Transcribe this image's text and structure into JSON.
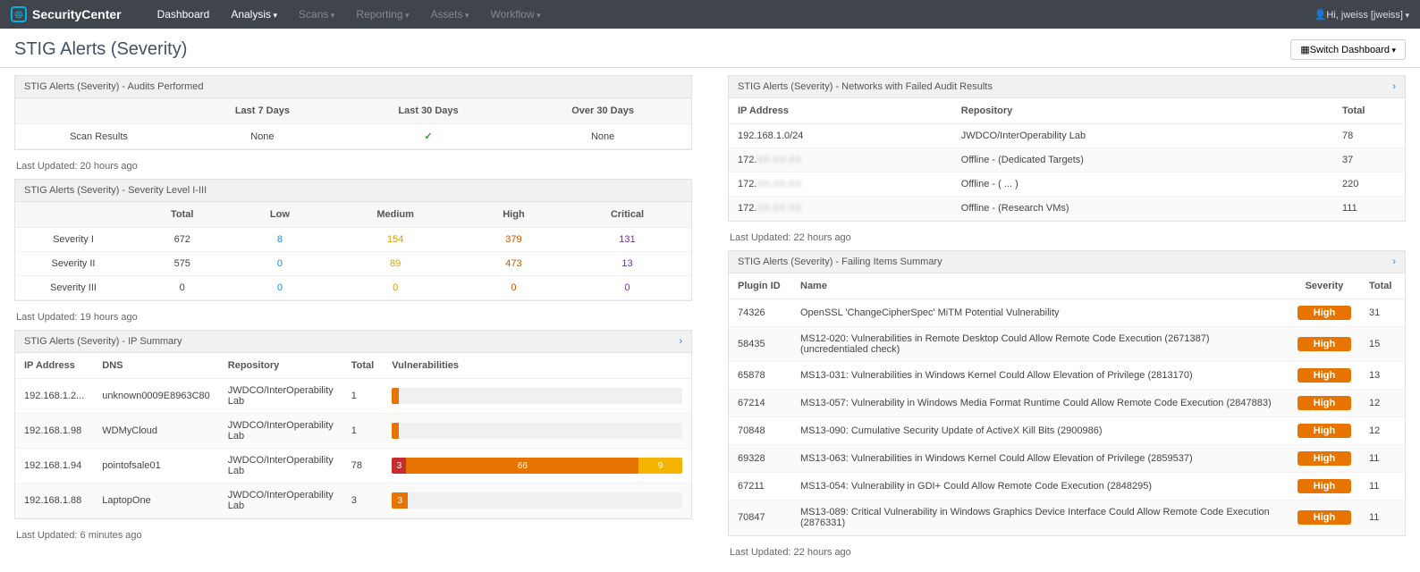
{
  "brand": "SecurityCenter",
  "nav": [
    "Dashboard",
    "Analysis",
    "Scans",
    "Reporting",
    "Assets",
    "Workflow"
  ],
  "user": "Hi, jweiss [jweiss]",
  "page_title": "STIG Alerts (Severity)",
  "switch_btn": "Switch Dashboard",
  "panels": {
    "audits": {
      "title": "STIG Alerts (Severity) - Audits Performed",
      "cols": [
        "Last 7 Days",
        "Last 30 Days",
        "Over 30 Days"
      ],
      "row_label": "Scan Results",
      "vals": [
        "None",
        "check",
        "None"
      ],
      "updated": "Last Updated: 20 hours ago"
    },
    "levels": {
      "title": "STIG Alerts (Severity) - Severity Level I-III",
      "cols": [
        "Total",
        "Low",
        "Medium",
        "High",
        "Critical"
      ],
      "rows": [
        {
          "label": "Severity I",
          "v": [
            "672",
            "8",
            "154",
            "379",
            "131"
          ]
        },
        {
          "label": "Severity II",
          "v": [
            "575",
            "0",
            "89",
            "473",
            "13"
          ]
        },
        {
          "label": "Severity III",
          "v": [
            "0",
            "0",
            "0",
            "0",
            "0"
          ]
        }
      ],
      "updated": "Last Updated: 19 hours ago"
    },
    "ipsum": {
      "title": "STIG Alerts (Severity) - IP Summary",
      "cols": [
        "IP Address",
        "DNS",
        "Repository",
        "Total",
        "Vulnerabilities"
      ],
      "rows": [
        {
          "ip": "192.168.1.2...",
          "dns": "unknown0009E8963C80",
          "repo": "JWDCO/InterOperability Lab",
          "total": "1",
          "bar": {
            "type": "one"
          }
        },
        {
          "ip": "192.168.1.98",
          "dns": "WDMyCloud",
          "repo": "JWDCO/InterOperability Lab",
          "total": "1",
          "bar": {
            "type": "one"
          }
        },
        {
          "ip": "192.168.1.94",
          "dns": "pointofsale01",
          "repo": "JWDCO/InterOperability Lab",
          "total": "78",
          "bar": {
            "type": "multi",
            "segs": [
              {
                "c": "#c82d2d",
                "w": 5,
                "t": "3"
              },
              {
                "c": "#e87400",
                "w": 80,
                "t": "66"
              },
              {
                "c": "#f4b400",
                "w": 15,
                "t": "9"
              }
            ]
          }
        },
        {
          "ip": "192.168.1.88",
          "dns": "LaptopOne",
          "repo": "JWDCO/InterOperability Lab",
          "total": "3",
          "bar": {
            "type": "small",
            "t": "3"
          }
        }
      ],
      "updated": "Last Updated: 6 minutes ago"
    },
    "networks": {
      "title": "STIG Alerts (Severity) - Networks with Failed Audit Results",
      "cols": [
        "IP Address",
        "Repository",
        "Total"
      ],
      "rows": [
        {
          "ip": "192.168.1.0/24",
          "repo": "JWDCO/InterOperability Lab",
          "total": "78",
          "blur": false
        },
        {
          "ip": "172.XX.XX.XX",
          "repo": "Offline - (Dedicated Targets)",
          "total": "37",
          "blur": true
        },
        {
          "ip": "172.XX.XX.XX",
          "repo": "Offline - ( ... )",
          "total": "220",
          "blur": true
        },
        {
          "ip": "172.XX.XX.XX",
          "repo": "Offline - (Research VMs)",
          "total": "111",
          "blur": true
        }
      ],
      "updated": "Last Updated: 22 hours ago"
    },
    "failing": {
      "title": "STIG Alerts (Severity) - Failing Items Summary",
      "cols": [
        "Plugin ID",
        "Name",
        "Severity",
        "Total"
      ],
      "rows": [
        {
          "id": "74326",
          "name": "OpenSSL 'ChangeCipherSpec' MiTM Potential Vulnerability",
          "sev": "High",
          "total": "31"
        },
        {
          "id": "58435",
          "name": "MS12-020: Vulnerabilities in Remote Desktop Could Allow Remote Code Execution (2671387) (uncredentialed check)",
          "sev": "High",
          "total": "15"
        },
        {
          "id": "65878",
          "name": "MS13-031: Vulnerabilities in Windows Kernel Could Allow Elevation of Privilege (2813170)",
          "sev": "High",
          "total": "13"
        },
        {
          "id": "67214",
          "name": "MS13-057: Vulnerability in Windows Media Format Runtime Could Allow Remote Code Execution (2847883)",
          "sev": "High",
          "total": "12"
        },
        {
          "id": "70848",
          "name": "MS13-090: Cumulative Security Update of ActiveX Kill Bits (2900986)",
          "sev": "High",
          "total": "12"
        },
        {
          "id": "69328",
          "name": "MS13-063: Vulnerabilities in Windows Kernel Could Allow Elevation of Privilege (2859537)",
          "sev": "High",
          "total": "11"
        },
        {
          "id": "67211",
          "name": "MS13-054: Vulnerability in GDI+ Could Allow Remote Code Execution (2848295)",
          "sev": "High",
          "total": "11"
        },
        {
          "id": "70847",
          "name": "MS13-089: Critical Vulnerability in Windows Graphics Device Interface Could Allow Remote Code Execution (2876331)",
          "sev": "High",
          "total": "11"
        }
      ],
      "updated": "Last Updated: 22 hours ago"
    }
  }
}
